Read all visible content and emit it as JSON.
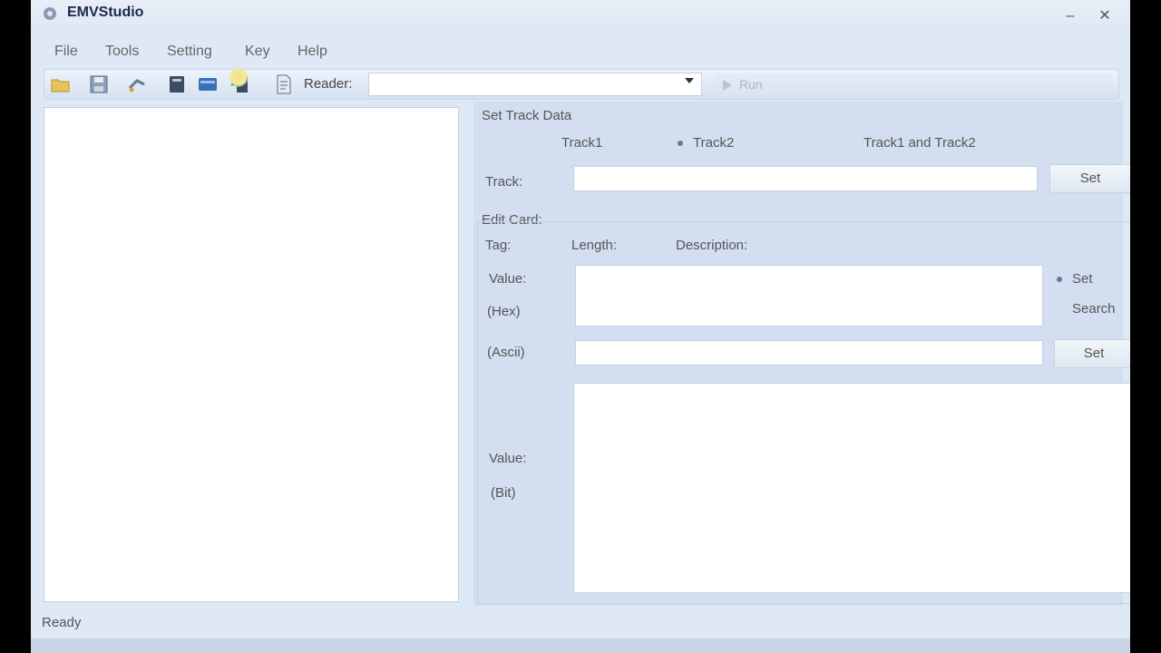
{
  "window": {
    "title": "EMVStudio",
    "minimize": "–",
    "close": "✕"
  },
  "menu": [
    {
      "label": "File"
    },
    {
      "label": "Tools"
    },
    {
      "label": "Setting"
    },
    {
      "label": "Key"
    },
    {
      "label": "Help"
    }
  ],
  "toolbar": {
    "icons": [
      "open-folder-icon",
      "save-icon",
      "connect-icon",
      "card-book-icon",
      "card-reader-icon",
      "exit-door-icon",
      "script-document-icon"
    ],
    "reader_label": "Reader:",
    "reader_value": "",
    "run_label": "Run"
  },
  "track_section": {
    "title": "Set Track Data",
    "options": [
      {
        "label": "Track1",
        "selected": false
      },
      {
        "label": "Track2",
        "selected": true
      },
      {
        "label": "Track1 and Track2",
        "selected": false
      }
    ],
    "track_label": "Track:",
    "track_value": "",
    "set_label": "Set"
  },
  "edit_card": {
    "title": "Edit Card:",
    "tag_label": "Tag:",
    "length_label": "Length:",
    "description_label": "Description:",
    "value_label": "Value:",
    "hex_label": "(Hex)",
    "hex_value": "",
    "mode_options": [
      {
        "label": "Set",
        "selected": true
      },
      {
        "label": "Search",
        "selected": false
      }
    ],
    "ascii_label": "(Ascii)",
    "ascii_value": "",
    "ascii_set_label": "Set",
    "bit_value_label": "Value:",
    "bit_label": "(Bit)",
    "bit_value": ""
  },
  "status": {
    "text": "Ready"
  },
  "colors": {
    "window_bg": "#dfe8f5",
    "panel_bg": "#d3dff0",
    "input_bg": "#ffffff"
  }
}
